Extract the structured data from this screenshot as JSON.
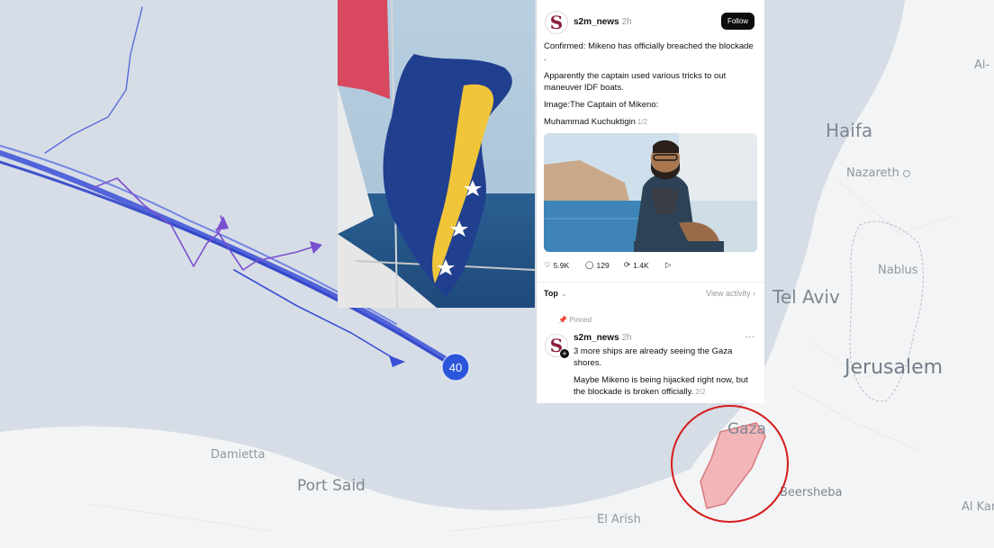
{
  "map": {
    "cities": {
      "haifa": "Haifa",
      "nazareth": "Nazareth",
      "tel_aviv": "Tel Aviv",
      "nablus": "Nablus",
      "jerusalem": "Jerusalem",
      "gaza": "Gaza",
      "beersheba": "Beersheba",
      "damietta": "Damietta",
      "port_said": "Port Said",
      "el_arish": "El Arish",
      "al_top_right": "Al-",
      "al_kar": "Al Kar"
    },
    "vessel_marker": "40",
    "colors": {
      "sea": "#d6dde6",
      "land": "#f3f4f5",
      "track": "#3a4fd6",
      "alt_track": "#7a4fd0",
      "gaza_fill": "#f3b6b8",
      "highlight_circle": "#d51c1c"
    }
  },
  "post": {
    "username": "s2m_news",
    "time": "2h",
    "follow_label": "Follow",
    "lines": [
      "Confirmed: Mikeno has officially breached the blockade .",
      "Apparently the captain used various tricks to out maneuver IDF boats.",
      "Image:The Captain of Mikeno:"
    ],
    "caption_last": "Muhammad Kuchuktigin",
    "caption_count": "1/2",
    "actions": {
      "likes": "5.9K",
      "replies": "129",
      "reposts": "1.4K"
    },
    "sort_label": "Top",
    "view_activity": "View activity",
    "avatar_letter": "S"
  },
  "reply": {
    "pinned_label": "Pinned",
    "username": "s2m_news",
    "time": "2h",
    "line1": "3 more ships are already seeing the Gaza shores.",
    "line2": "Maybe Mikeno is being hijacked right now, but the blockade is broken officially.",
    "count": "2/2",
    "more": "..."
  }
}
